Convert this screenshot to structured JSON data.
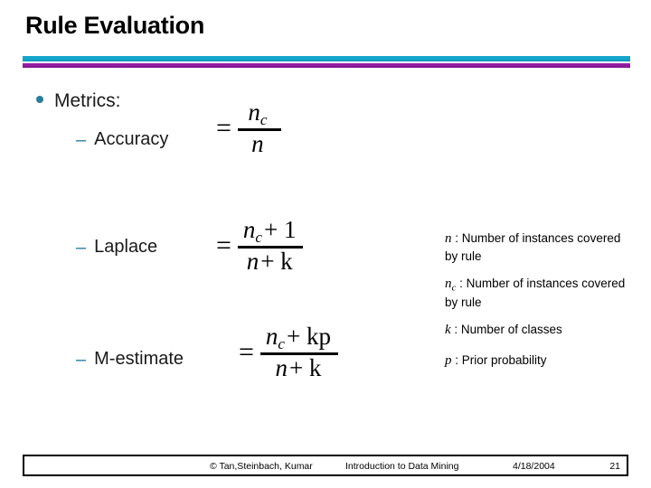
{
  "slide": {
    "title": "Rule Evaluation",
    "accent_cyan": "#14a4c9",
    "accent_purple": "#8f1a9c",
    "bullet_color": "#2a7d9c"
  },
  "body": {
    "heading": "Metrics:",
    "items": [
      {
        "dash": "–",
        "label": "Accuracy"
      },
      {
        "dash": "–",
        "label": "Laplace"
      },
      {
        "dash": "–",
        "label": "M-estimate"
      }
    ],
    "formulas": [
      {
        "name": "accuracy",
        "equals": "=",
        "numerator": "n",
        "numerator_sub": "c",
        "numerator_rest": "",
        "denominator": "n",
        "denominator_rest": ""
      },
      {
        "name": "laplace",
        "equals": "=",
        "numerator": "n",
        "numerator_sub": "c",
        "numerator_rest": "+ 1",
        "denominator": "n",
        "denominator_rest": "+ k"
      },
      {
        "name": "m-estimate",
        "equals": "=",
        "numerator": "n",
        "numerator_sub": "c",
        "numerator_rest": "+ kp",
        "denominator": "n",
        "denominator_rest": "+ k"
      }
    ]
  },
  "legend": [
    {
      "symbol": "n",
      "subscript": "",
      "text": " : Number of instances covered by rule"
    },
    {
      "symbol": "n",
      "subscript": "c",
      "text": " : Number of instances covered by rule"
    },
    {
      "symbol": "k",
      "subscript": "",
      "text": " : Number of classes"
    },
    {
      "symbol": "p",
      "subscript": "",
      "text": " : Prior probability"
    }
  ],
  "footer": {
    "copyright": "© Tan,Steinbach, Kumar",
    "course": "Introduction to Data Mining",
    "date": "4/18/2004",
    "page": "21"
  }
}
